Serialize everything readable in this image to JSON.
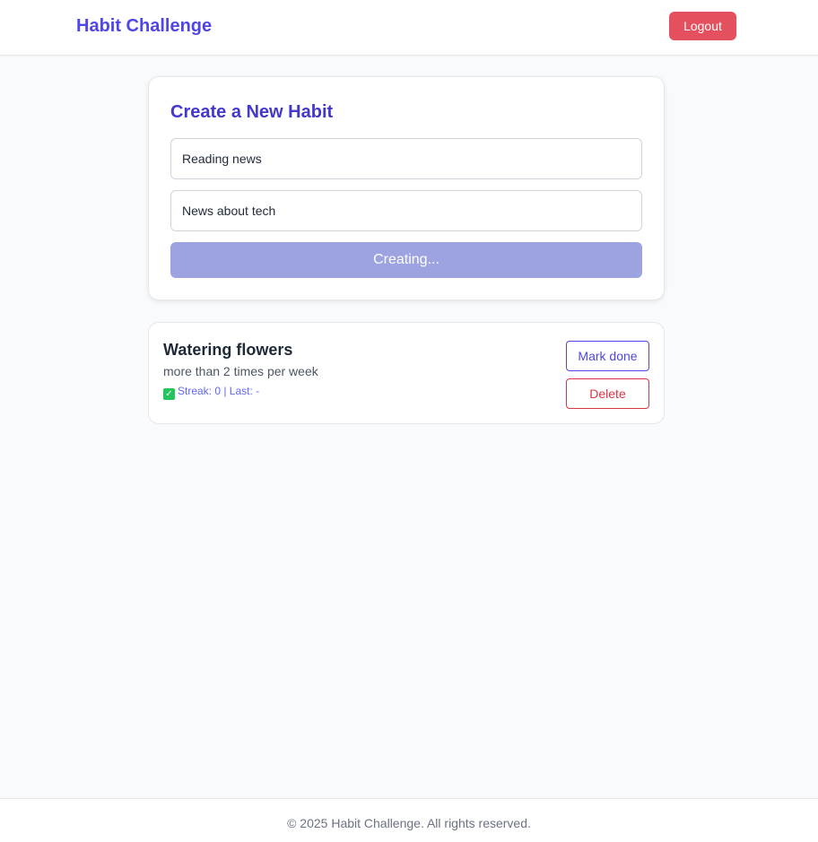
{
  "header": {
    "brand": "Habit Challenge",
    "logout_label": "Logout"
  },
  "create_form": {
    "title": "Create a New Habit",
    "name_value": "Reading news",
    "description_value": "News about tech",
    "submit_label": "Creating...",
    "submit_state": "disabled"
  },
  "habits": [
    {
      "name": "Watering flowers",
      "frequency": "more than 2 times per week",
      "status_icon": "check-mark-icon",
      "status_text": "Streak: 0 | Last: -",
      "mark_done_label": "Mark done",
      "delete_label": "Delete"
    }
  ],
  "footer": {
    "text": "© 2025 Habit Challenge. All rights reserved."
  },
  "colors": {
    "brand": "#4f46e5",
    "logout": "#e5505f",
    "submit_disabled": "#9ca3e0",
    "delete": "#dc3545",
    "background": "#f8fafc"
  }
}
